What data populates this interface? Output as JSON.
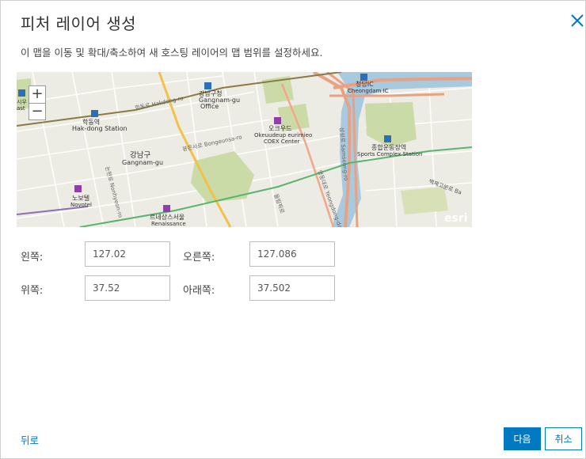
{
  "dialog": {
    "title": "피처 레이어 생성",
    "subtitle": "이 맵을 이동 및 확대/축소하여 새 호스팅 레이어의 맵 범위를 설정하세요."
  },
  "map": {
    "zoom_in": "+",
    "zoom_out": "−",
    "attribution": "esri",
    "labels": {
      "gangnam_office_ko": "강남구청",
      "gangnam_office_en": "Gangnam-gu",
      "gangnam_office_en2": "Office",
      "hakdong_ko": "학동역",
      "hakdong_en": "Hak-dong Station",
      "gangnamgu_ko": "강남구",
      "gangnamgu_en": "Gangnam-gu",
      "coex_ko": "오크우드",
      "coex_en": "Okeuudeup eurimieo",
      "coex_en2": "COEX Center",
      "sports_ko": "종합운동장역",
      "sports_en": "Sports Complex Station",
      "novotel_ko": "노보텔",
      "novotel_en": "Novotel",
      "renaissance_ko": "르네상스서울",
      "renaissance_en": "Renaissance",
      "cheongdam_ko": "청담IC",
      "cheongdam_en": "Cheongdam IC",
      "hakdong_ro": "학동로 Hakdong-ro",
      "bongeunsa_ro": "봉은사로 Bongeunsa-ro",
      "nonhyeon_ro": "논현로 Nonhyeon-ro",
      "samseong_ro": "삼성로 Samseong-ro",
      "yeongdong_ro": "영동대로 Yeongdong-daero",
      "olympic_ro": "올림픽로",
      "baekje": "백제고분로 Ba",
      "edge_left": "시우",
      "edge_left2": "ast"
    }
  },
  "extent": {
    "left_label": "왼쪽:",
    "left_value": "127.02",
    "right_label": "오른쪽:",
    "right_value": "127.086",
    "top_label": "위쪽:",
    "top_value": "37.52",
    "bottom_label": "아래쪽:",
    "bottom_value": "37.502"
  },
  "footer": {
    "back_label": "뒤로",
    "next_label": "다음",
    "cancel_label": "취소"
  },
  "colors": {
    "accent": "#0079c1",
    "map_background": "#ecebe4",
    "park_green": "#cbdba8",
    "river": "#a9c9de",
    "highway": "#e9a183",
    "major_road": "#f2c14a",
    "subway_marker": "#2b6fb6",
    "poi_marker": "#8f3fa8"
  },
  "icons": {
    "close": "close-icon",
    "subway": "subway-station-icon",
    "hotel": "hotel-poi-icon"
  }
}
